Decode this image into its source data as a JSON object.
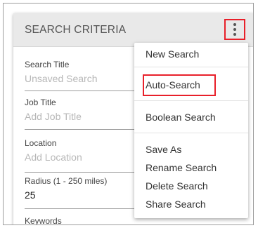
{
  "card": {
    "title": "SEARCH CRITERIA",
    "menu_icon": "more-vert-icon"
  },
  "form": {
    "search_title": {
      "label": "Search Title",
      "placeholder": "Unsaved Search"
    },
    "job_title": {
      "label": "Job Title",
      "placeholder": "Add Job Title"
    },
    "location": {
      "label": "Location",
      "placeholder": "Add Location"
    },
    "radius": {
      "label": "Radius (1 - 250 miles)",
      "value": "25"
    },
    "keywords": {
      "label": "Keywords"
    }
  },
  "menu": {
    "new_search": "New Search",
    "auto_search": "Auto-Search",
    "boolean_search": "Boolean Search",
    "save_as": "Save As",
    "rename_search": "Rename Search",
    "delete_search": "Delete Search",
    "share_search": "Share Search"
  },
  "colors": {
    "header_bg": "#e9e9e9",
    "highlight": "#e8202a",
    "placeholder_text": "#b7b7b7"
  }
}
